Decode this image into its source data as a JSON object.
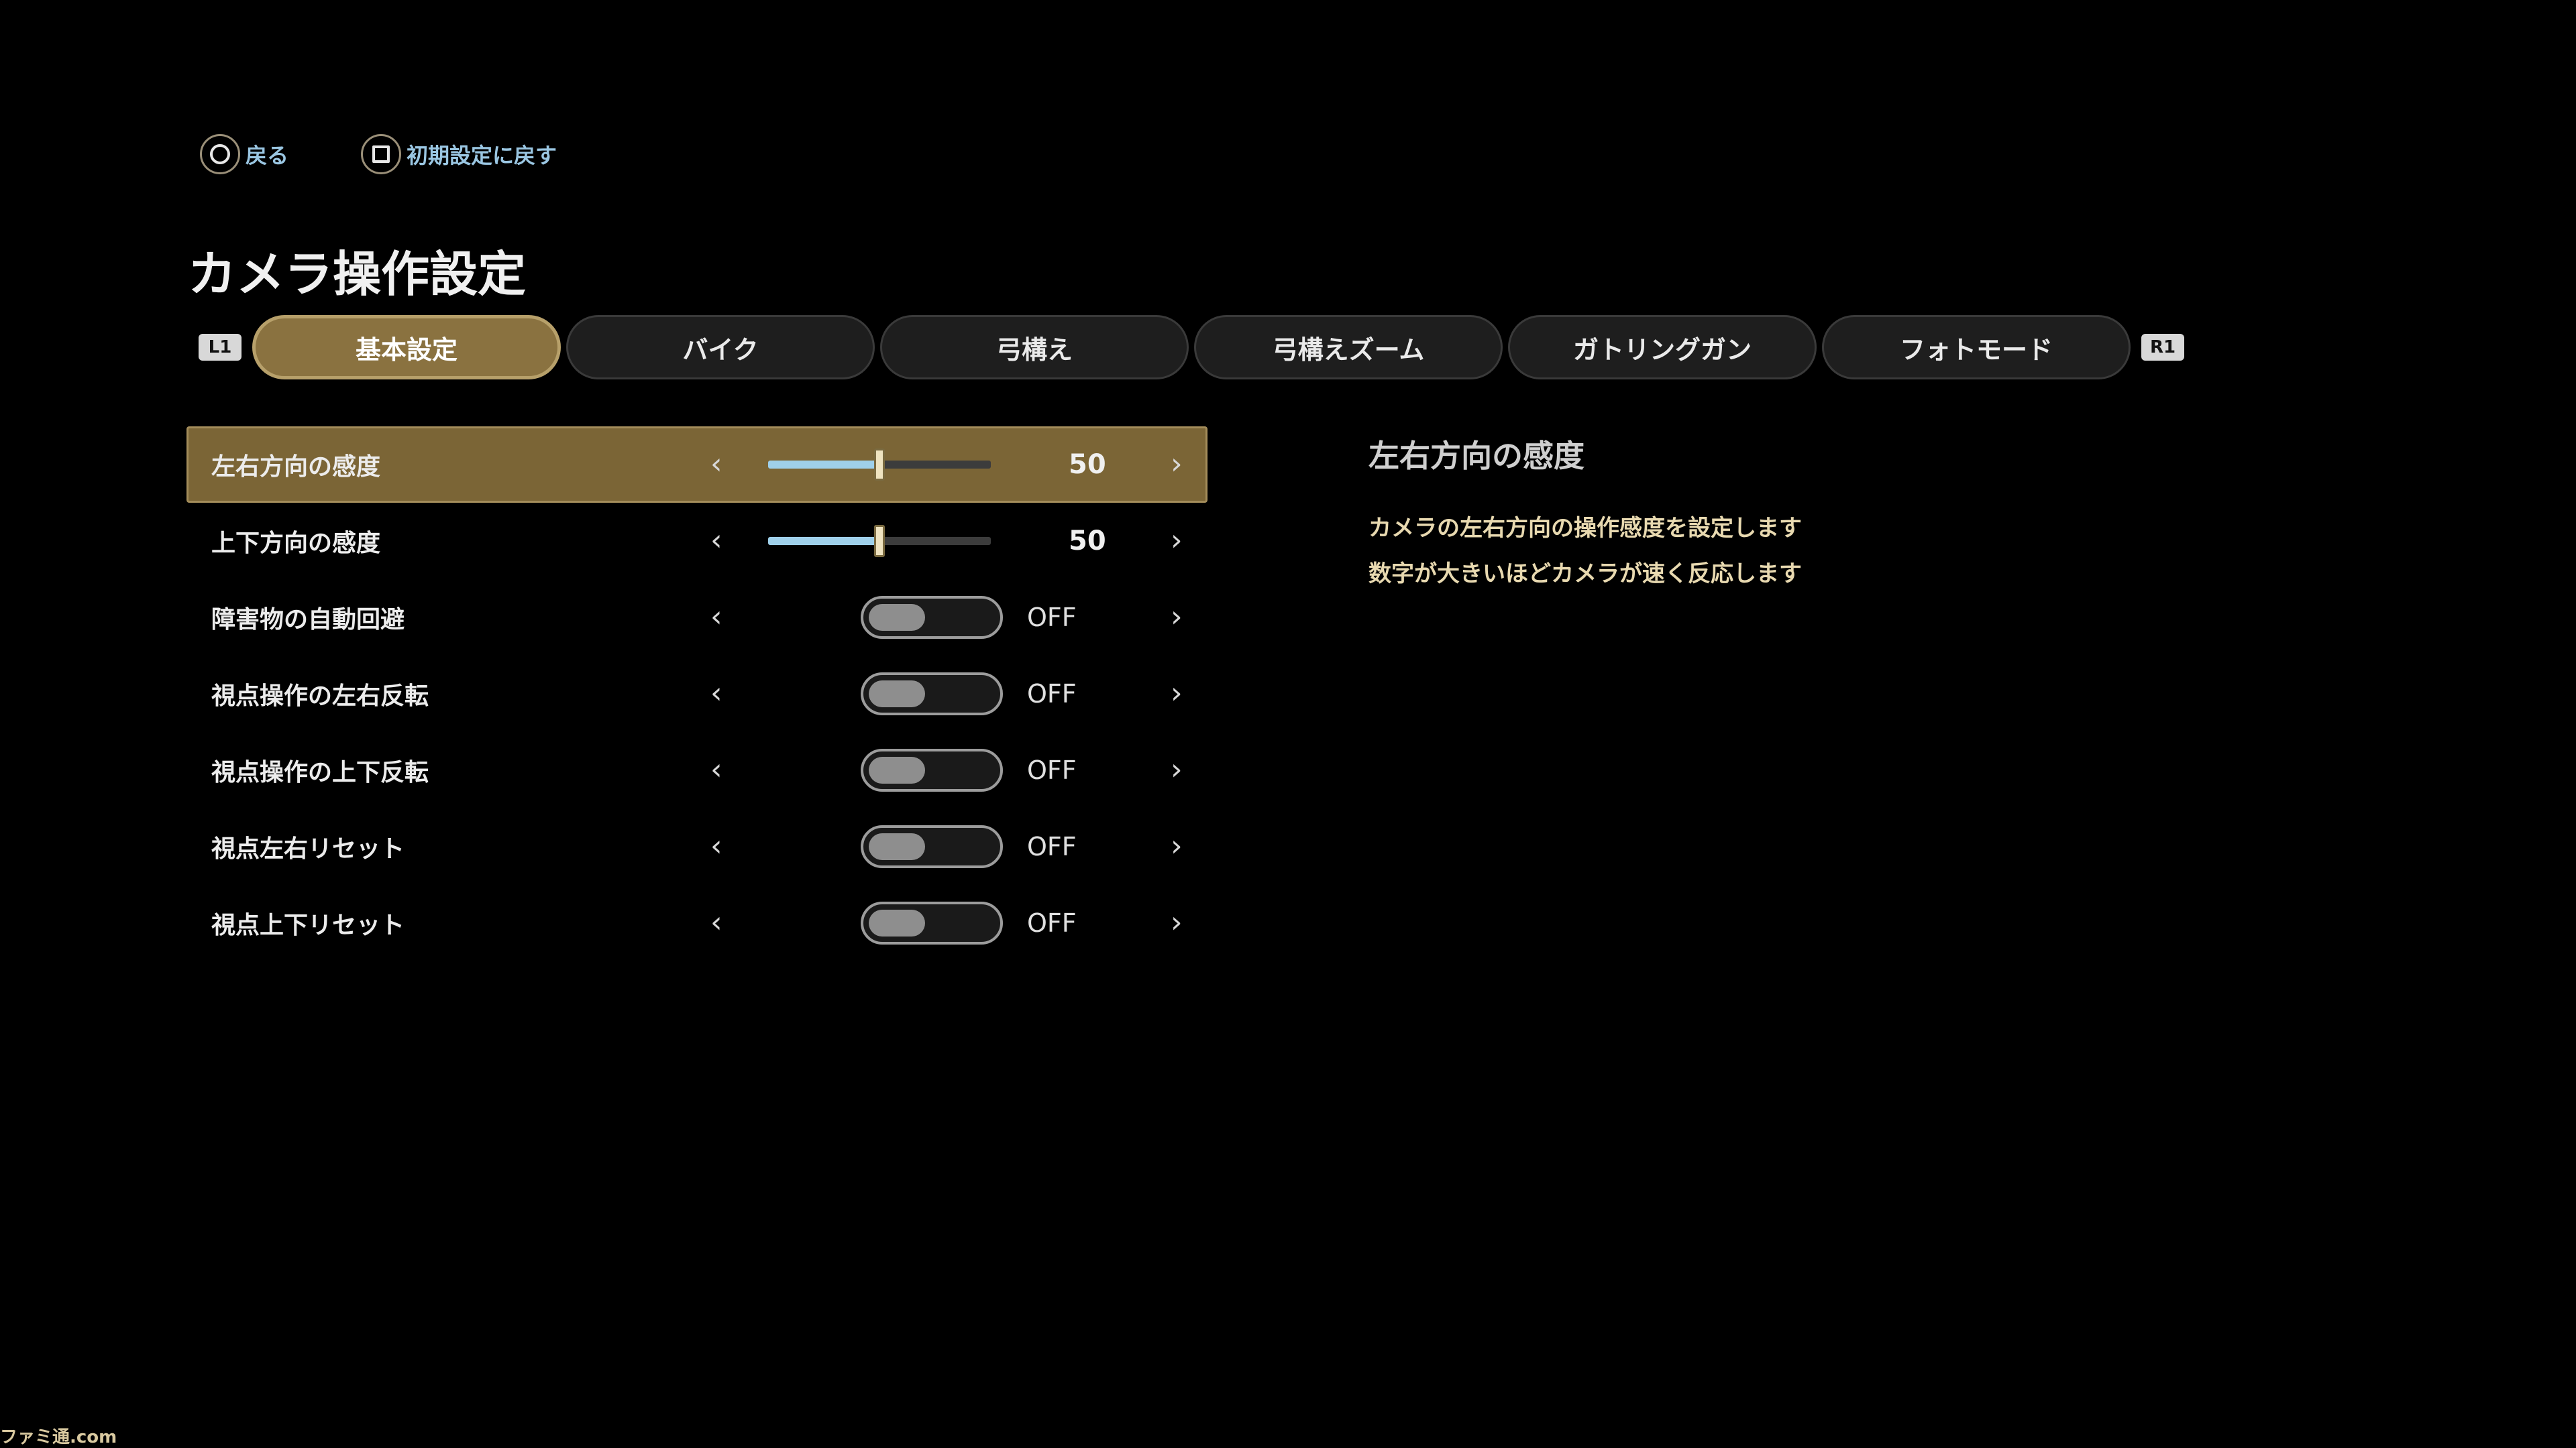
{
  "hints": [
    {
      "icon": "circle-button-icon",
      "label": "戻る"
    },
    {
      "icon": "square-button-icon",
      "label": "初期設定に戻す"
    }
  ],
  "title": "カメラ操作設定",
  "tabs": {
    "left_shoulder": "L1",
    "right_shoulder": "R1",
    "items": [
      {
        "label": "基本設定",
        "active": true
      },
      {
        "label": "バイク",
        "active": false
      },
      {
        "label": "弓構え",
        "active": false
      },
      {
        "label": "弓構えズーム",
        "active": false
      },
      {
        "label": "ガトリングガン",
        "active": false
      },
      {
        "label": "フォトモード",
        "active": false
      }
    ]
  },
  "settings": [
    {
      "label": "左右方向の感度",
      "type": "slider",
      "value": "50",
      "fraction": 0.5,
      "selected": true
    },
    {
      "label": "上下方向の感度",
      "type": "slider",
      "value": "50",
      "fraction": 0.5,
      "selected": false
    },
    {
      "label": "障害物の自動回避",
      "type": "toggle",
      "value": "OFF",
      "selected": false
    },
    {
      "label": "視点操作の左右反転",
      "type": "toggle",
      "value": "OFF",
      "selected": false
    },
    {
      "label": "視点操作の上下反転",
      "type": "toggle",
      "value": "OFF",
      "selected": false
    },
    {
      "label": "視点左右リセット",
      "type": "toggle",
      "value": "OFF",
      "selected": false
    },
    {
      "label": "視点上下リセット",
      "type": "toggle",
      "value": "OFF",
      "selected": false
    }
  ],
  "description": {
    "title": "左右方向の感度",
    "lines": [
      "カメラの左右方向の操作感度を設定します",
      "数字が大きいほどカメラが速く反応します"
    ]
  },
  "arrows": {
    "left": "‹",
    "right": "›"
  },
  "watermark": "ファミ通.com",
  "colors": {
    "accent_gold": "#8a7240",
    "slider_fill": "#9fd0ea",
    "hint_text": "#9ac6e2",
    "description_text": "#e8d9b0"
  }
}
